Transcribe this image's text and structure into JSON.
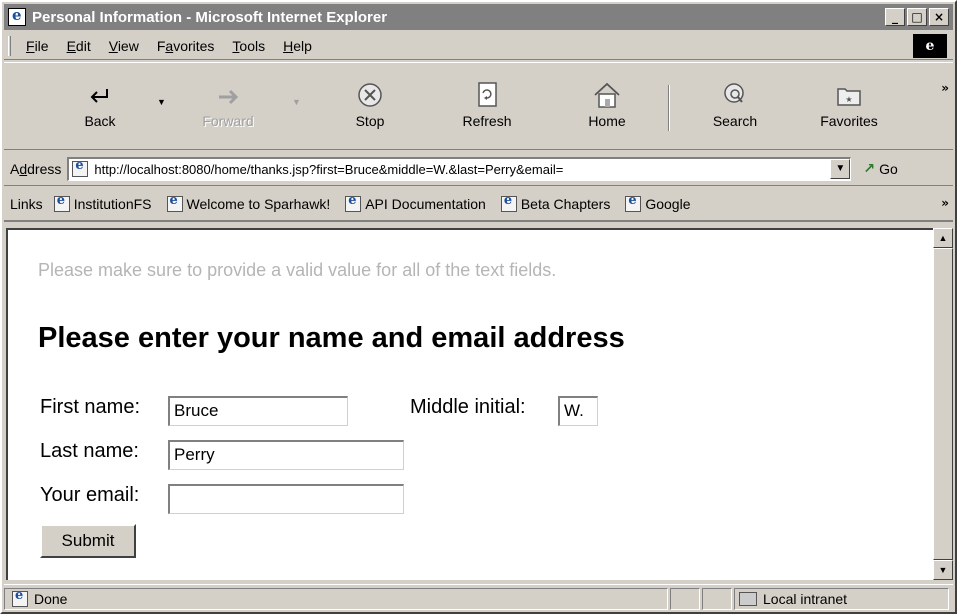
{
  "window": {
    "title": "Personal Information - Microsoft Internet Explorer",
    "minimize": "_",
    "maximize": "□",
    "close": "×"
  },
  "menu": {
    "file": {
      "key": "F",
      "rest": "ile"
    },
    "edit": {
      "key": "E",
      "rest": "dit"
    },
    "view": {
      "key": "V",
      "rest": "iew"
    },
    "favorites": {
      "pre": "F",
      "key": "a",
      "rest": "vorites"
    },
    "tools": {
      "key": "T",
      "rest": "ools"
    },
    "help": {
      "key": "H",
      "rest": "elp"
    }
  },
  "toolbar": {
    "back": "Back",
    "forward": "Forward",
    "stop": "Stop",
    "refresh": "Refresh",
    "home": "Home",
    "search": "Search",
    "favorites": "Favorites",
    "more": "»"
  },
  "address": {
    "label_pre": "A",
    "label_key": "d",
    "label_rest": "dress",
    "url": "http://localhost:8080/home/thanks.jsp?first=Bruce&middle=W.&last=Perry&email=",
    "go": "Go"
  },
  "links": {
    "label": "Links",
    "items": [
      "InstitutionFS",
      "Welcome to Sparhawk!",
      "API Documentation",
      "Beta Chapters",
      "Google"
    ],
    "more": "»"
  },
  "page": {
    "message": "Please make sure to provide a valid value for all of the text fields.",
    "heading": "Please enter your name and email address",
    "first_label": "First name:",
    "first_value": "Bruce",
    "middle_label": "Middle initial:",
    "middle_value": "W.",
    "last_label": "Last name:",
    "last_value": "Perry",
    "email_label": "Your email:",
    "email_value": "",
    "submit": "Submit"
  },
  "status": {
    "text": "Done",
    "zone": "Local intranet"
  }
}
